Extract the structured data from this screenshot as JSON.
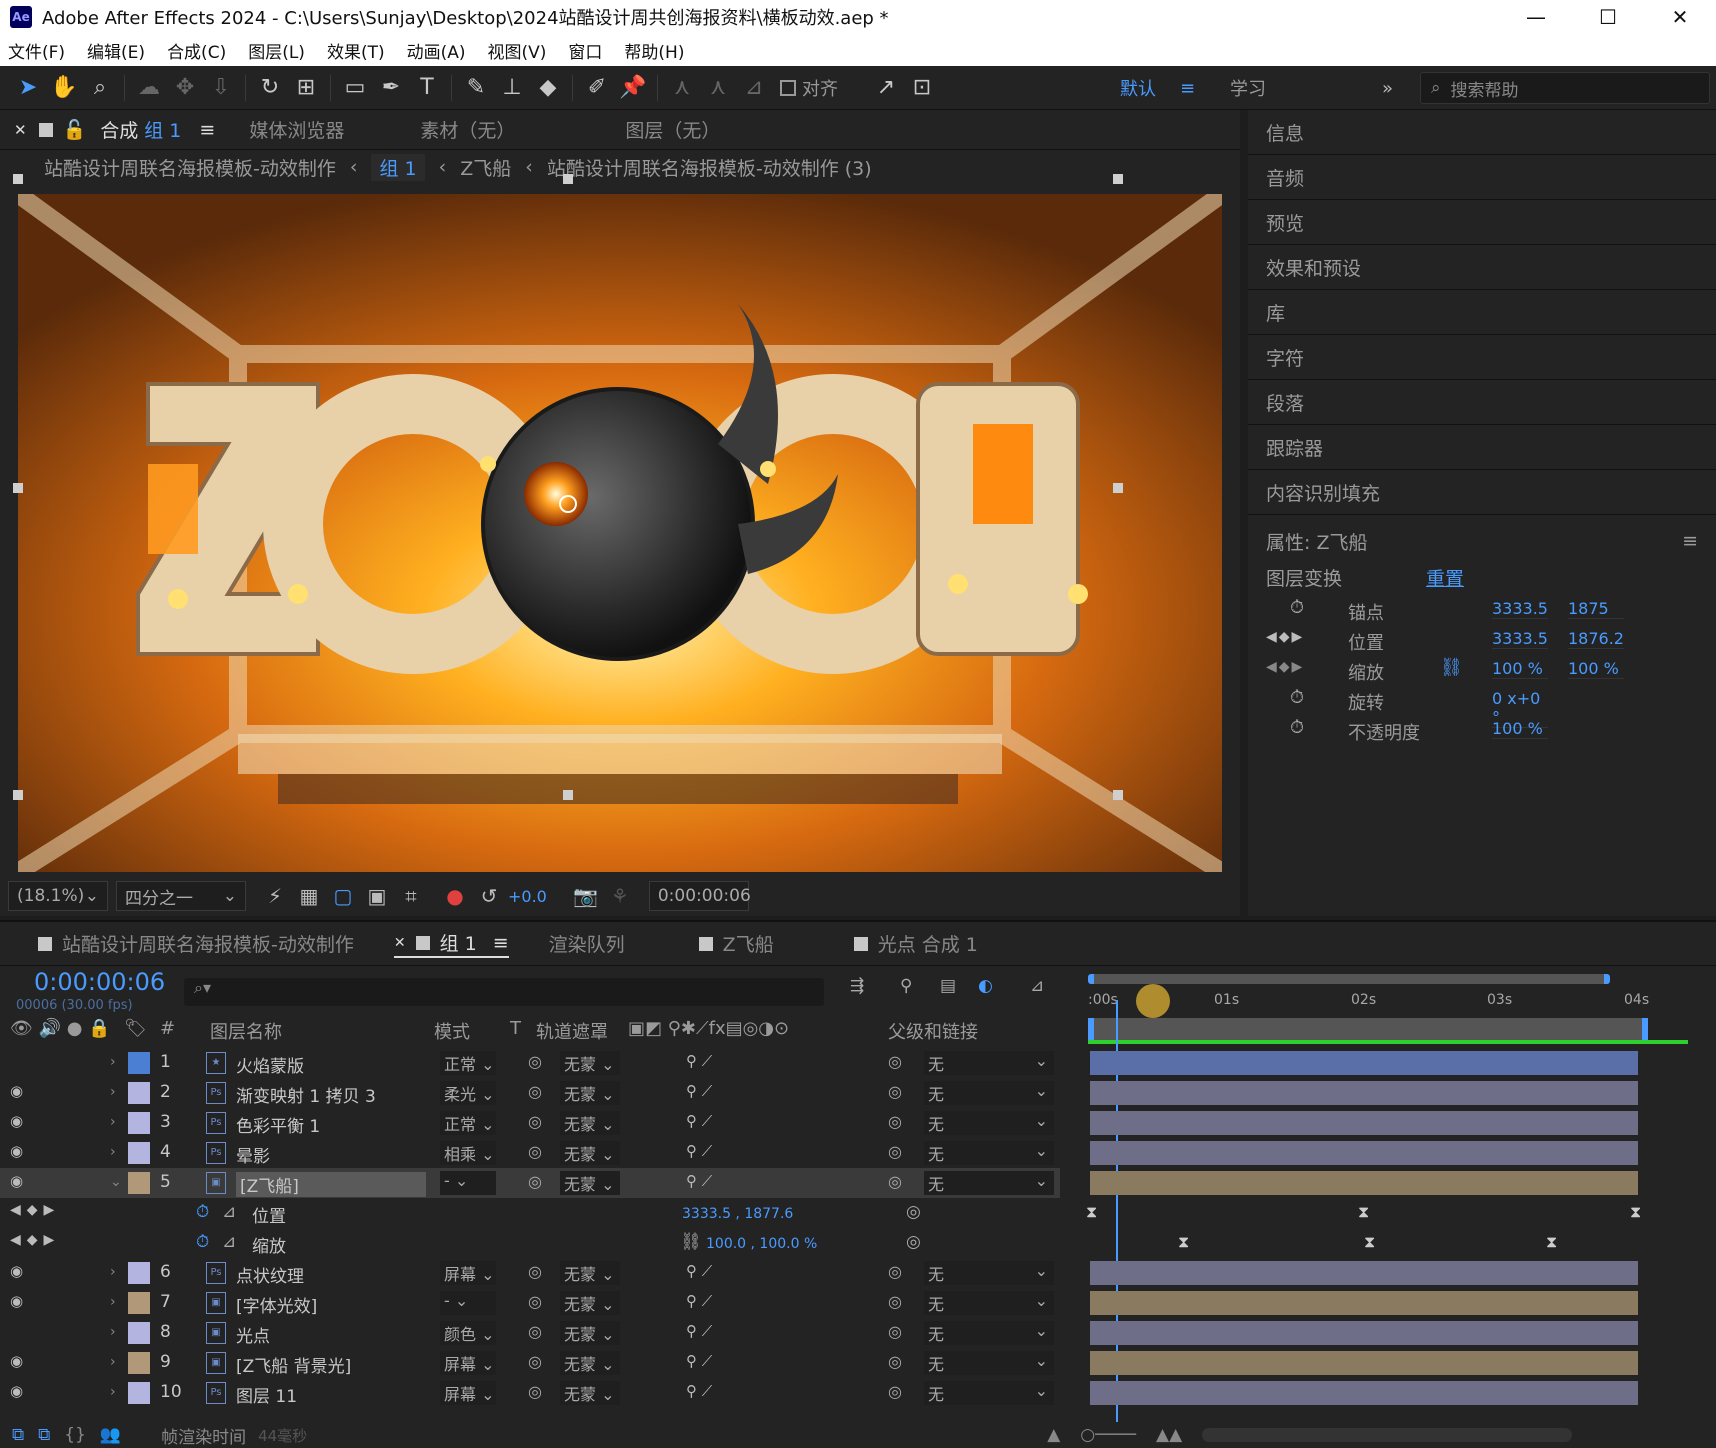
{
  "titlebar": {
    "app_icon": "Ae",
    "title": "Adobe After Effects 2024 - C:\\Users\\Sunjay\\Desktop\\2024站酷设计周共创海报资料\\横板动效.aep *",
    "minimize": "—",
    "maximize": "☐",
    "close": "✕"
  },
  "menu": [
    "文件(F)",
    "编辑(E)",
    "合成(C)",
    "图层(L)",
    "效果(T)",
    "动画(A)",
    "视图(V)",
    "窗口",
    "帮助(H)"
  ],
  "toolbar": {
    "snap_label": "对齐",
    "workspace_default": "默认",
    "workspace_learn": "学习",
    "search_placeholder": "搜索帮助"
  },
  "comp_panel": {
    "tab_comp_prefix": "合成",
    "tab_comp_name": "组 1",
    "tab_media": "媒体浏览器",
    "tab_footage": "素材（无）",
    "tab_layer": "图层（无）",
    "breadcrumb": [
      "站酷设计周联名海报模板-动效制作",
      "组 1",
      "Z飞船",
      "站酷设计周联名海报模板-动效制作 (3)"
    ],
    "zoom": "(18.1%)",
    "resolution": "四分之一",
    "exposure": "+0.0",
    "timecode": "0:00:00:06"
  },
  "right_panel": {
    "items": [
      "信息",
      "音频",
      "预览",
      "效果和预设",
      "库",
      "字符",
      "段落",
      "跟踪器",
      "内容识别填充"
    ],
    "properties_title": "属性: Z飞船",
    "layer_transform": "图层变换",
    "reset": "重置",
    "props": [
      {
        "name": "锚点",
        "v1": "3333.5",
        "v2": "1875"
      },
      {
        "name": "位置",
        "v1": "3333.5",
        "v2": "1876.2"
      },
      {
        "name": "缩放",
        "v1": "100 %",
        "v2": "100 %"
      },
      {
        "name": "旋转",
        "v1": "0 x+0 °",
        "v2": ""
      },
      {
        "name": "不透明度",
        "v1": "100 %",
        "v2": ""
      }
    ]
  },
  "timeline": {
    "tabs": [
      "站酷设计周联名海报模板-动效制作",
      "组 1",
      "渲染队列",
      "Z飞船",
      "光点 合成 1"
    ],
    "timecode": "0:00:00:06",
    "framecount": "00006 (30.00 fps)",
    "headers": {
      "num": "#",
      "name": "图层名称",
      "mode": "模式",
      "t": "T",
      "matte": "轨道遮罩",
      "parent": "父级和链接"
    },
    "ruler": [
      ":00s",
      "01s",
      "02s",
      "03s",
      "04s"
    ],
    "layers": [
      {
        "num": "1",
        "name": "火焰蒙版",
        "mode": "正常",
        "matte": "无蒙",
        "parent": "无",
        "color": "#4a7fd4",
        "eye": "",
        "type": "solid"
      },
      {
        "num": "2",
        "name": "渐变映射 1 拷贝 3",
        "mode": "柔光",
        "matte": "无蒙",
        "parent": "无",
        "color": "#b4b4e0",
        "eye": "👁",
        "type": "ps"
      },
      {
        "num": "3",
        "name": "色彩平衡 1",
        "mode": "正常",
        "matte": "无蒙",
        "parent": "无",
        "color": "#b4b4e0",
        "eye": "👁",
        "type": "ps"
      },
      {
        "num": "4",
        "name": "晕影",
        "mode": "相乘",
        "matte": "无蒙",
        "parent": "无",
        "color": "#b4b4e0",
        "eye": "👁",
        "type": "ps"
      },
      {
        "num": "5",
        "name": "[Z飞船]",
        "mode": "-",
        "matte": "无蒙",
        "parent": "无",
        "color": "#b09878",
        "eye": "👁",
        "type": "comp"
      },
      {
        "num": "6",
        "name": "点状纹理",
        "mode": "屏幕",
        "matte": "无蒙",
        "parent": "无",
        "color": "#b4b4e0",
        "eye": "👁",
        "type": "ps"
      },
      {
        "num": "7",
        "name": "[字体光效]",
        "mode": "-",
        "matte": "无蒙",
        "parent": "无",
        "color": "#b09878",
        "eye": "👁",
        "type": "comp"
      },
      {
        "num": "8",
        "name": "光点",
        "mode": "颜色",
        "matte": "无蒙",
        "parent": "无",
        "color": "#b4b4e0",
        "eye": "",
        "type": "comp"
      },
      {
        "num": "9",
        "name": "[Z飞船 背景光]",
        "mode": "屏幕",
        "matte": "无蒙",
        "parent": "无",
        "color": "#b09878",
        "eye": "👁",
        "type": "comp"
      },
      {
        "num": "10",
        "name": "图层 11",
        "mode": "屏幕",
        "matte": "无蒙",
        "parent": "无",
        "color": "#b4b4e0",
        "eye": "👁",
        "type": "ps"
      }
    ],
    "sub_props": [
      {
        "name": "位置",
        "value": "3333.5 , 1877.6"
      },
      {
        "name": "缩放",
        "value": "100.0 , 100.0 %"
      }
    ],
    "status_label": "帧渲染时间",
    "status_value": "44毫秒"
  }
}
